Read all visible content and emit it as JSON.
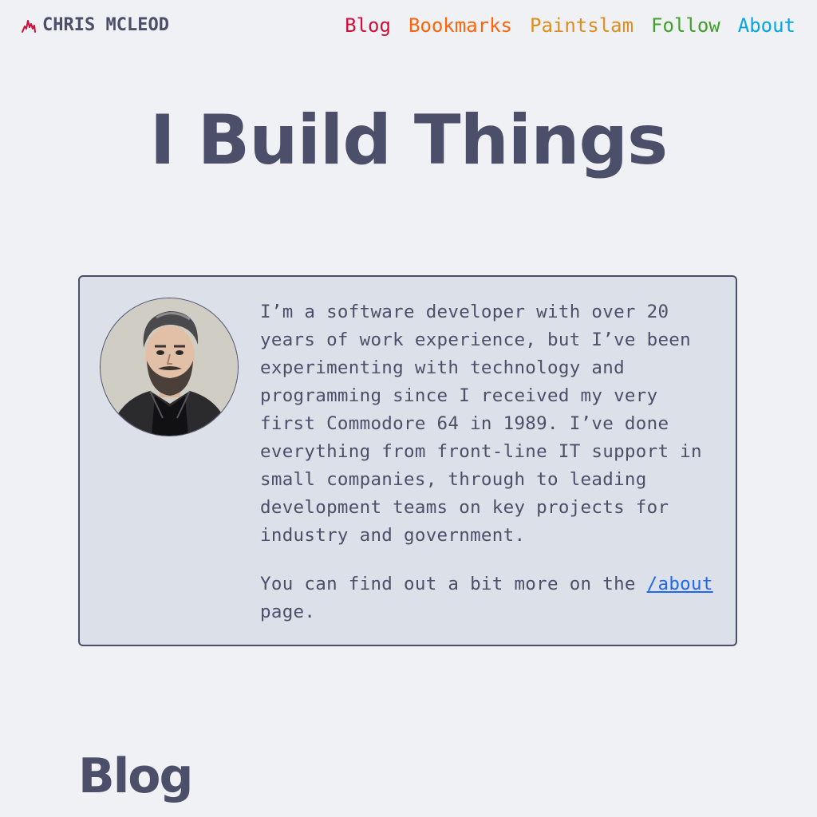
{
  "header": {
    "logo_text": "CHRIS MCLEOD",
    "logo_icon": "flame-icon",
    "logo_color": "#d20f39"
  },
  "nav": {
    "items": [
      {
        "label": "Blog",
        "color": "#d20f39"
      },
      {
        "label": "Bookmarks",
        "color": "#fe640b"
      },
      {
        "label": "Paintslam",
        "color": "#df8e1d"
      },
      {
        "label": "Follow",
        "color": "#40a02b"
      },
      {
        "label": "About",
        "color": "#04a5e5"
      }
    ]
  },
  "hero": {
    "title": "I Build Things"
  },
  "intro": {
    "avatar_alt": "portrait-illustration",
    "paragraph1": "I’m a software developer with over 20 years of work experience, but I’ve been experimenting with technology and programming since I received my very first Commodore 64 in 1989. I’ve done everything from front-line IT support in small companies, through to leading development teams on key projects for industry and government.",
    "paragraph2_prefix": "You can find out a bit more on the ",
    "about_link": "/about",
    "paragraph2_suffix": " page."
  },
  "sections": {
    "blog_title": "Blog"
  },
  "colors": {
    "background": "#eff1f5",
    "text": "#4c4f69",
    "card_background": "#dce0e8",
    "link": "#1e66f5"
  }
}
